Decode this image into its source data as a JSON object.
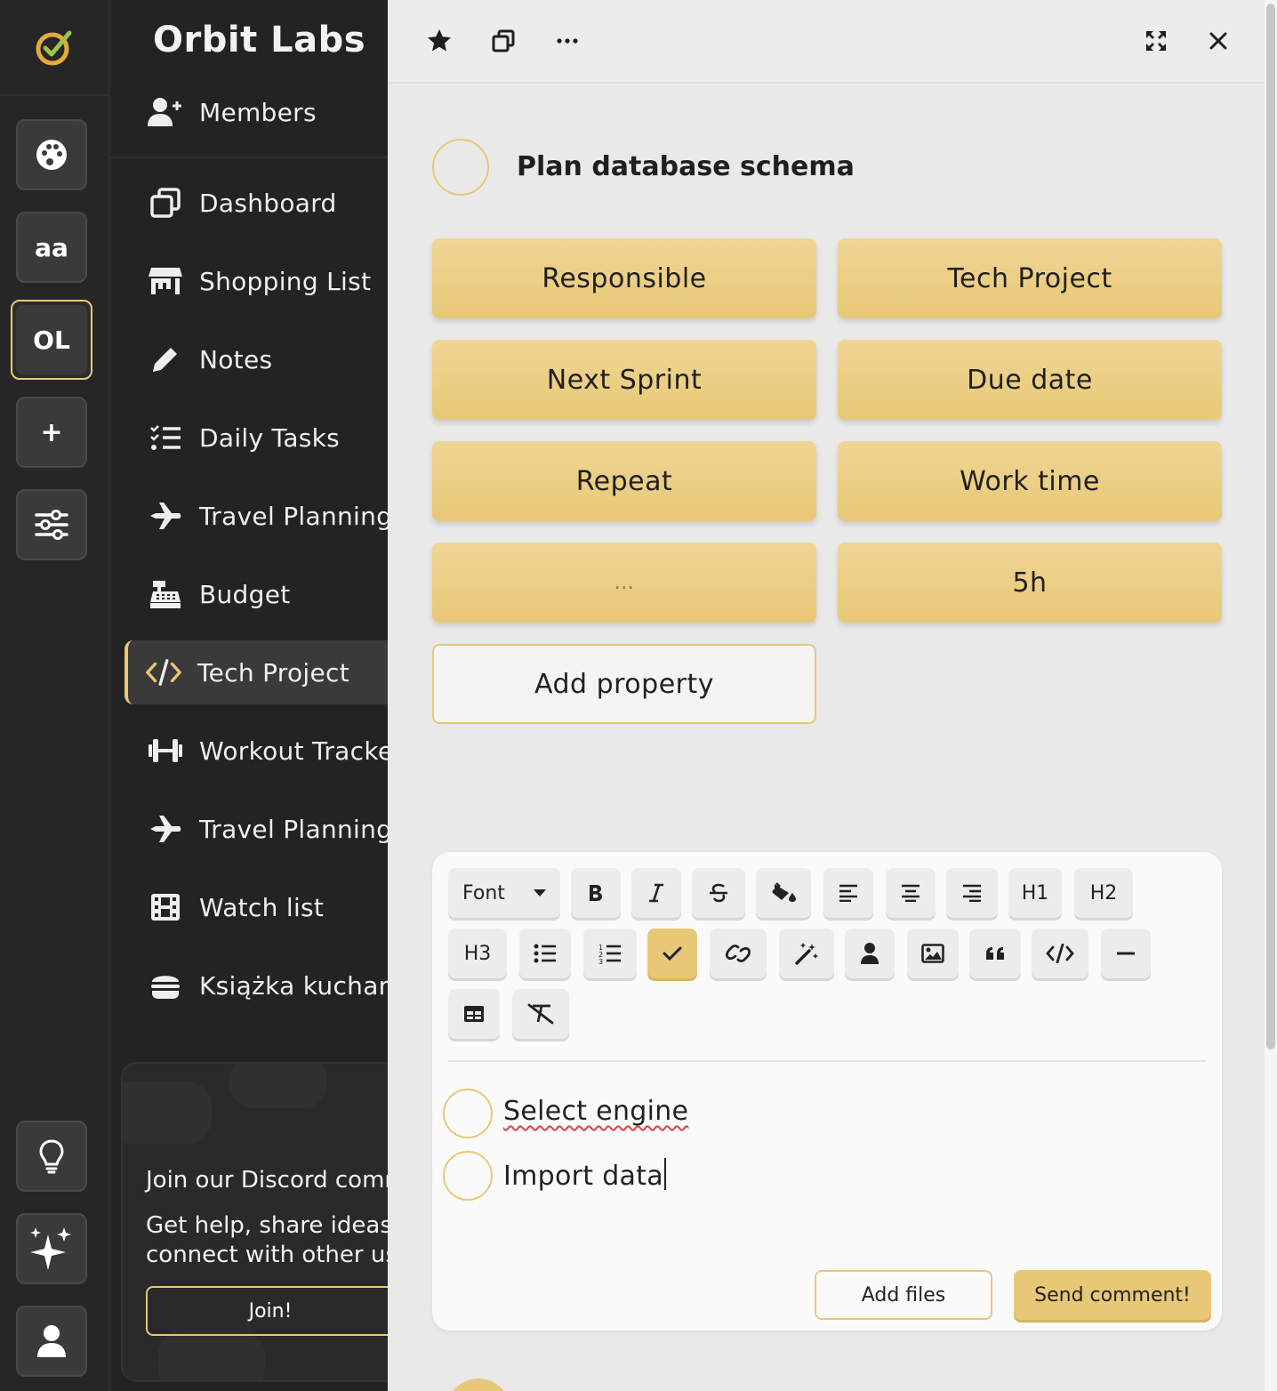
{
  "brand": {
    "name": "Orbit Labs"
  },
  "rail": {
    "items": [
      {
        "icon": "palette-icon",
        "label": ""
      },
      {
        "icon": "",
        "label": "aa"
      },
      {
        "icon": "",
        "label": "OL",
        "active": true
      },
      {
        "icon": "plus-icon",
        "label": "+"
      },
      {
        "icon": "sliders-icon",
        "label": ""
      }
    ],
    "bottom": [
      {
        "icon": "lightbulb-icon"
      },
      {
        "icon": "sparkles-icon"
      },
      {
        "icon": "user-icon"
      }
    ]
  },
  "sidebar": {
    "items": [
      {
        "label": "Members",
        "icon": "user-plus-icon"
      },
      {
        "label": "Dashboard",
        "icon": "windows-icon"
      },
      {
        "label": "Shopping List",
        "icon": "store-icon"
      },
      {
        "label": "Notes",
        "icon": "pencil-icon"
      },
      {
        "label": "Daily Tasks",
        "icon": "list-check-icon"
      },
      {
        "label": "Travel Planning",
        "icon": "plane-icon"
      },
      {
        "label": "Budget",
        "icon": "cash-register-icon"
      },
      {
        "label": "Tech Project",
        "icon": "code-icon",
        "active": true
      },
      {
        "label": "Workout Tracker",
        "icon": "dumbbell-icon"
      },
      {
        "label": "Travel Planning",
        "icon": "plane-icon"
      },
      {
        "label": "Watch list",
        "icon": "film-icon"
      },
      {
        "label": "Książka kucharska",
        "icon": "burger-icon"
      }
    ],
    "discord": {
      "title": "Join our Discord community",
      "text": "Get help, share ideas and connect with other users",
      "button": "Join!"
    }
  },
  "topbar": {
    "icons": [
      "star-icon",
      "window-restore-icon",
      "ellipsis-icon",
      "expand-icon",
      "close-icon"
    ]
  },
  "task": {
    "title": "Plan database schema",
    "properties": [
      "Responsible",
      "Tech Project",
      "Next Sprint",
      "Due date",
      "Repeat",
      "Work time",
      "...",
      "5h"
    ],
    "add_property": "Add property"
  },
  "editor": {
    "font_label": "Font",
    "toolbar": [
      "bold",
      "italic",
      "strikethrough",
      "fill",
      "align-left",
      "align-center",
      "align-right",
      "H1",
      "H2",
      "H3",
      "bullet-list",
      "ordered-list",
      "check",
      "link",
      "magic",
      "mention",
      "image",
      "quote",
      "code",
      "hr",
      "table",
      "clear-format"
    ],
    "h1": "H1",
    "h2": "H2",
    "h3": "H3",
    "checklist": [
      {
        "text": "Select engine"
      },
      {
        "text": "Import data"
      }
    ],
    "add_files": "Add files",
    "send": "Send comment!"
  },
  "colors": {
    "accent": "#e8c877",
    "sidebar_bg": "#232323",
    "main_bg": "#e9e9e9"
  }
}
